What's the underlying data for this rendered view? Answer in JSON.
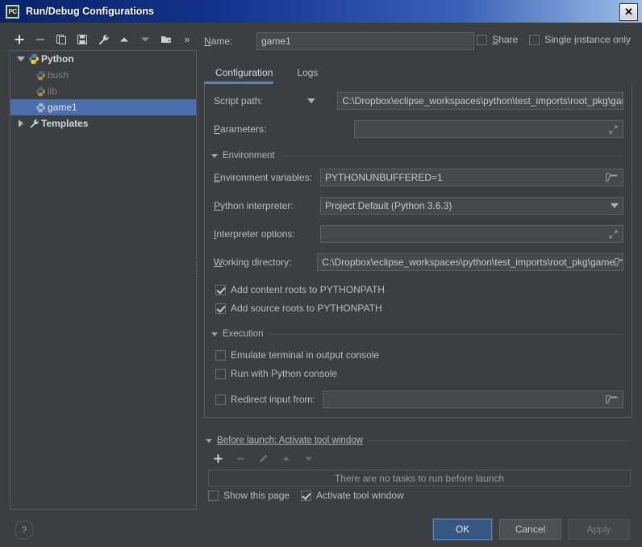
{
  "window": {
    "title": "Run/Debug Configurations",
    "app_icon": "pycharm-icon",
    "app_icon_text": "PC",
    "close_label": "✕"
  },
  "left_toolbar": {
    "buttons": [
      {
        "name": "add-configuration-button",
        "icon": "plus-icon"
      },
      {
        "name": "remove-configuration-button",
        "icon": "minus-icon"
      },
      {
        "name": "copy-configuration-button",
        "icon": "copy-icon"
      },
      {
        "name": "save-configuration-button",
        "icon": "save-icon"
      },
      {
        "name": "edit-templates-button",
        "icon": "wrench-icon"
      },
      {
        "name": "move-up-button",
        "icon": "arrow-up-icon"
      },
      {
        "name": "move-down-button",
        "icon": "arrow-down-icon"
      },
      {
        "name": "move-into-folder-button",
        "icon": "folder-add-icon"
      },
      {
        "name": "overflow-button",
        "icon": "chevron-double-right-icon",
        "label": "»"
      }
    ]
  },
  "tree": {
    "nodes": [
      {
        "label": "Python",
        "icon": "python-icon",
        "state": "expanded",
        "style": "bold",
        "level": 0
      },
      {
        "label": "bush",
        "icon": "python-config-icon",
        "state": "leaf",
        "style": "dim",
        "level": 1
      },
      {
        "label": "lib",
        "icon": "python-config-icon",
        "state": "leaf",
        "style": "dim",
        "level": 1
      },
      {
        "label": "game1",
        "icon": "python-config-icon",
        "state": "leaf",
        "style": "selected",
        "level": 1
      },
      {
        "label": "Templates",
        "icon": "wrench-icon",
        "state": "collapsed",
        "style": "bold",
        "level": 0
      }
    ]
  },
  "header": {
    "name_label": "Name:",
    "name_value": "game1",
    "share_label": "Share",
    "share_checked": false,
    "single_instance_label": "Single instance only",
    "single_instance_checked": false
  },
  "tabs": [
    {
      "label": "Configuration",
      "active": true
    },
    {
      "label": "Logs",
      "active": false
    }
  ],
  "configuration": {
    "script_path": {
      "label": "Script path:",
      "value": "C:\\Dropbox\\eclipse_workspaces\\python\\test_imports\\root_pkg\\game\\g",
      "has_combo": true,
      "browse_icon": "folder-browse-icon"
    },
    "parameters": {
      "label": "Parameters:",
      "value": "",
      "expand_icon": "expand-editor-icon"
    },
    "environment_section": {
      "title": "Environment",
      "expanded": true
    },
    "environment_variables": {
      "label": "Environment variables:",
      "value": "PYTHONUNBUFFERED=1",
      "browse_icon": "folder-browse-icon"
    },
    "python_interpreter": {
      "label": "Python interpreter:",
      "value": "Project Default (Python 3.6.3)",
      "dropdown_icon": "chevron-down-icon"
    },
    "interpreter_options": {
      "label": "Interpreter options:",
      "value": "",
      "expand_icon": "expand-editor-icon"
    },
    "working_directory": {
      "label": "Working directory:",
      "value": "C:\\Dropbox\\eclipse_workspaces\\python\\test_imports\\root_pkg\\game",
      "browse_icon": "folder-browse-icon"
    },
    "add_content_roots": {
      "label": "Add content roots to PYTHONPATH",
      "checked": true
    },
    "add_source_roots": {
      "label": "Add source roots to PYTHONPATH",
      "checked": true
    },
    "execution_section": {
      "title": "Execution",
      "expanded": true
    },
    "emulate_terminal": {
      "label": "Emulate terminal in output console",
      "checked": false
    },
    "run_with_python_console": {
      "label": "Run with Python console",
      "checked": false
    },
    "redirect_input": {
      "label": "Redirect input from:",
      "checked": false,
      "value": "",
      "browse_icon": "folder-browse-icon"
    }
  },
  "before_launch": {
    "title": "Before launch: Activate tool window",
    "expanded": true,
    "toolbar": [
      {
        "name": "add-task-button",
        "icon": "plus-icon",
        "enabled": true
      },
      {
        "name": "remove-task-button",
        "icon": "minus-icon",
        "enabled": false
      },
      {
        "name": "edit-task-button",
        "icon": "pencil-icon",
        "enabled": false
      },
      {
        "name": "task-move-up-button",
        "icon": "arrow-up-icon",
        "enabled": false
      },
      {
        "name": "task-move-down-button",
        "icon": "arrow-down-icon",
        "enabled": false
      }
    ],
    "empty_text": "There are no tasks to run before launch",
    "show_this_page": {
      "label": "Show this page",
      "checked": false
    },
    "activate_tool_window": {
      "label": "Activate tool window",
      "checked": true
    }
  },
  "footer": {
    "help_label": "?",
    "ok_label": "OK",
    "cancel_label": "Cancel",
    "apply_label": "Apply",
    "apply_enabled": false
  },
  "colors": {
    "background": "#3c3f41",
    "panel_border": "#555759",
    "field_background": "#45494a",
    "selection": "#4b6eaf",
    "accent": "#4a88c7",
    "primary_button": "#365880",
    "title_bar_start": "#0a246a",
    "text": "#bbbbbb"
  }
}
